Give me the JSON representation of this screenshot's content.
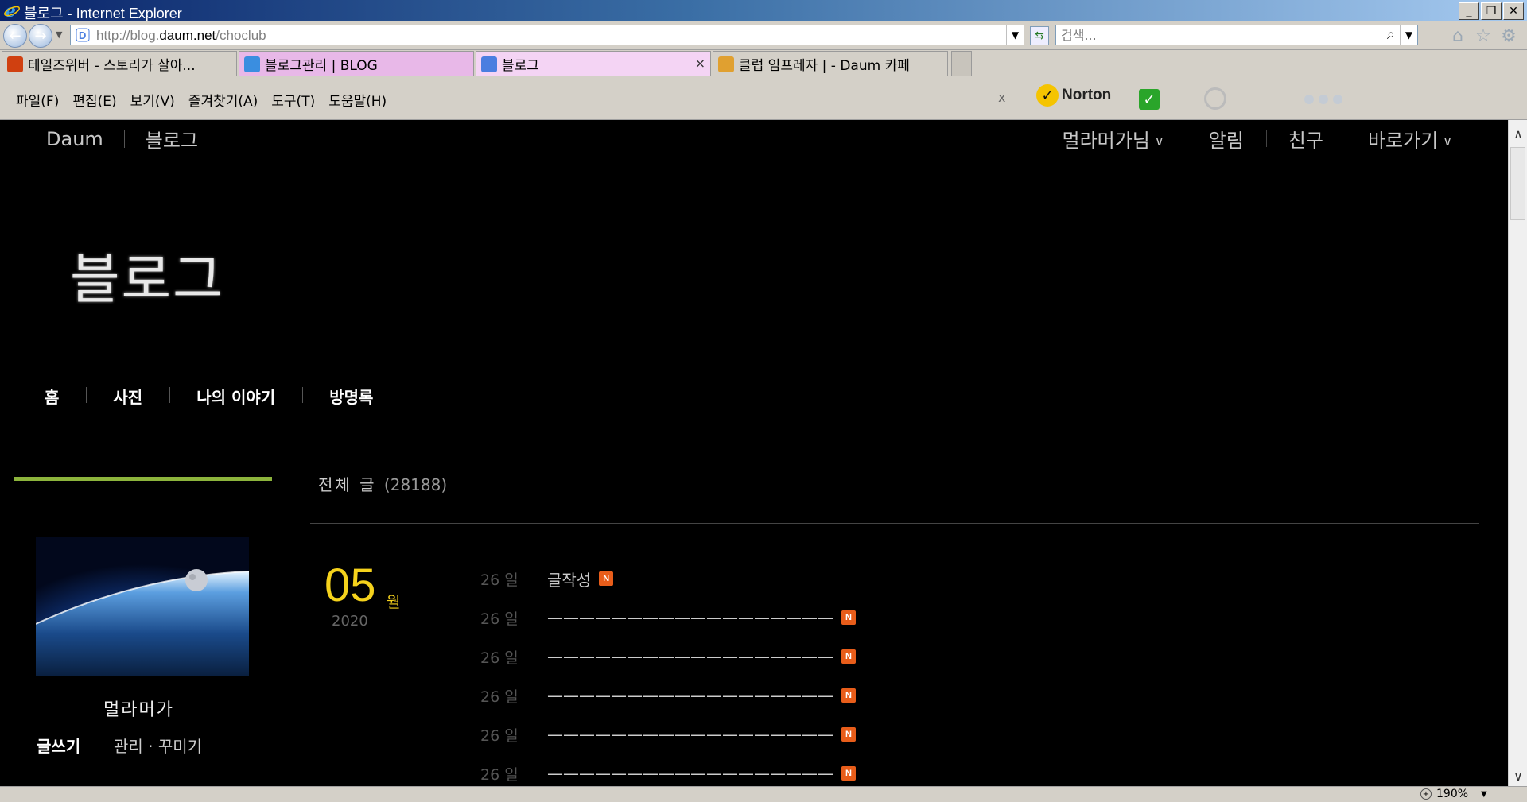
{
  "window": {
    "title": "블로그 - Internet Explorer"
  },
  "address": {
    "prefix": "http://blog.",
    "domain": "daum.net",
    "path": "/choclub"
  },
  "search": {
    "placeholder": "검색..."
  },
  "tabs": [
    {
      "label": "테일즈위버 - 스토리가 살아...",
      "color": "#d4d0c8",
      "icon_color": "#d04010"
    },
    {
      "label": "블로그관리 | BLOG",
      "color": "#e8b8e8",
      "icon_color": "#3a8ee0"
    },
    {
      "label": "블로그",
      "color": "#f4d4f4",
      "icon_color": "#4a7ee0",
      "active": true
    },
    {
      "label": "클럽 임프레자 | - Daum 카페",
      "color": "#d4d0c8",
      "icon_color": "#e0a030"
    }
  ],
  "menu": [
    "파일(F)",
    "편집(E)",
    "보기(V)",
    "즐겨찾기(A)",
    "도구(T)",
    "도움말(H)"
  ],
  "toolbar": {
    "close_label": "x",
    "norton_label": "Norton"
  },
  "blog": {
    "top_left": [
      "Daum",
      "블로그"
    ],
    "top_right": [
      {
        "label": "멀라머가님",
        "dropdown": true
      },
      {
        "label": "알림",
        "dropdown": false
      },
      {
        "label": "친구",
        "dropdown": false
      },
      {
        "label": "바로가기",
        "dropdown": true
      }
    ],
    "title": "블로그",
    "nav": [
      "홈",
      "사진",
      "나의 이야기",
      "방명록"
    ],
    "profile": {
      "name": "멀라머가",
      "write": "글쓰기",
      "manage": "관리 · 꾸미기"
    },
    "posts_header": {
      "label": "전체 글",
      "count": "(28188)"
    },
    "date": {
      "month": "05",
      "month_unit": "월",
      "year": "2020"
    },
    "posts": [
      {
        "day": "26 일",
        "title": "글작성"
      },
      {
        "day": "26 일",
        "title": "——————————————————"
      },
      {
        "day": "26 일",
        "title": "——————————————————"
      },
      {
        "day": "26 일",
        "title": "——————————————————"
      },
      {
        "day": "26 일",
        "title": "——————————————————"
      },
      {
        "day": "26 일",
        "title": "——————————————————"
      }
    ],
    "new_badge": "N",
    "accent_color": "#8cb43c",
    "date_color": "#f5d21c"
  },
  "status": {
    "zoom": "190%"
  }
}
